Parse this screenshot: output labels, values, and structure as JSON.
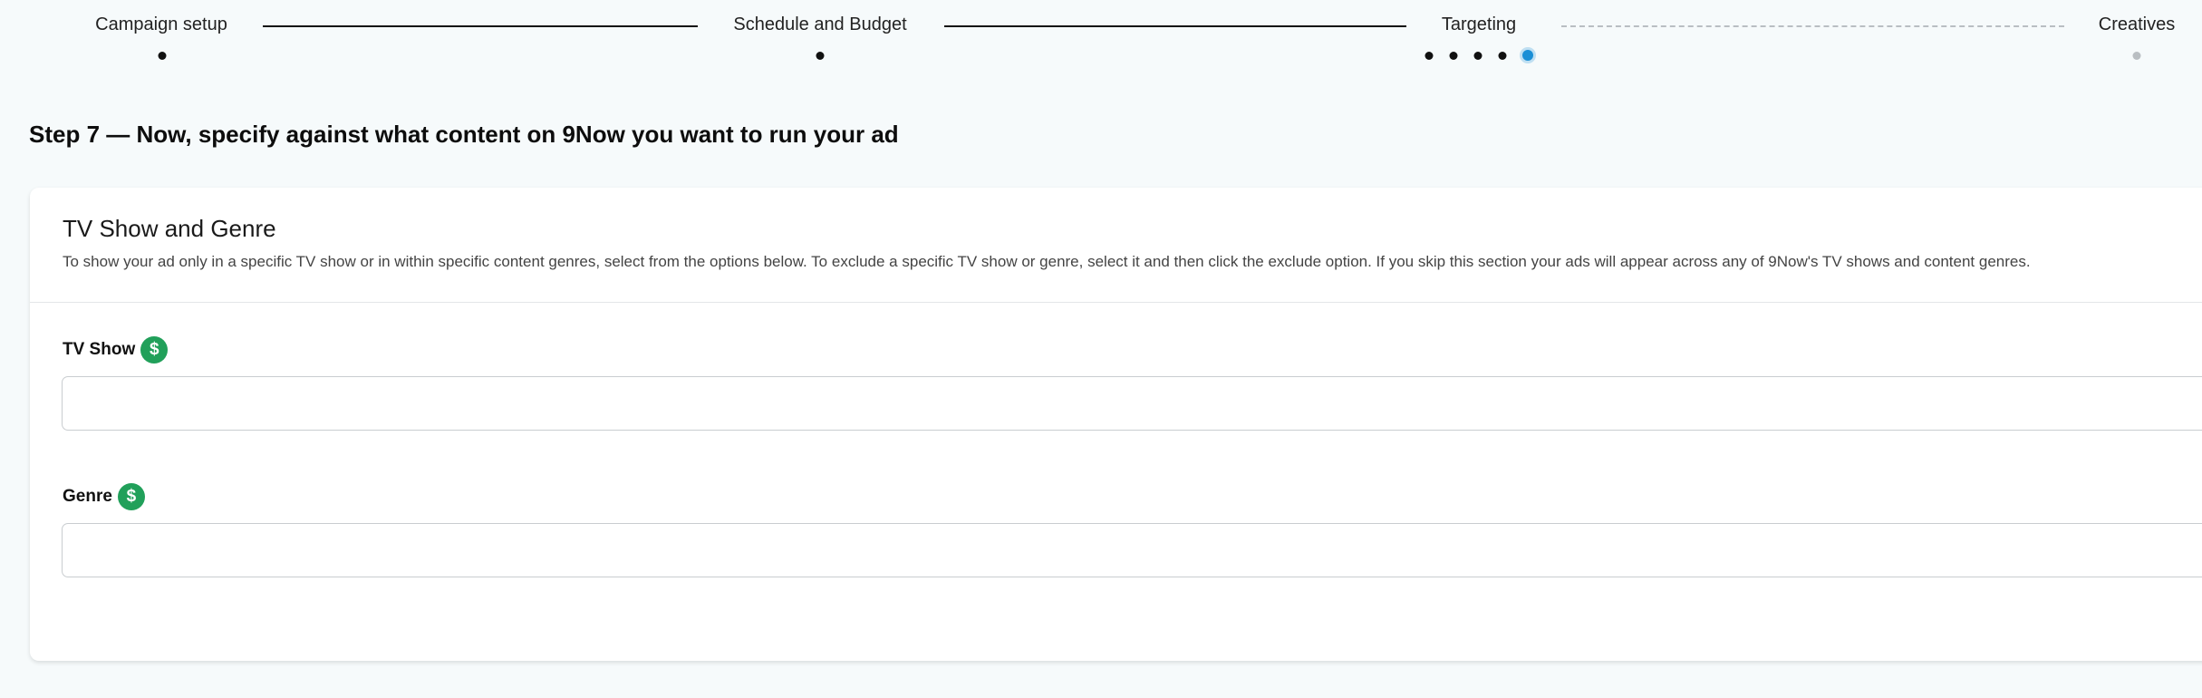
{
  "stepper": {
    "steps": [
      {
        "label": "Campaign setup",
        "state": "completed"
      },
      {
        "label": "Schedule and Budget",
        "state": "completed"
      },
      {
        "label": "Targeting",
        "state": "current",
        "substeps_total": 5,
        "substep_current": 5
      },
      {
        "label": "Creatives",
        "state": "upcoming"
      }
    ],
    "colors": {
      "completed": "#111111",
      "active": "#1a8fd6",
      "upcoming": "#b9bec2"
    }
  },
  "page": {
    "heading": "Step 7 — Now, specify against what content on 9Now you want to run your ad"
  },
  "card": {
    "title": "TV Show and Genre",
    "description": "To show your ad only in a specific TV show or in within specific content genres, select from the options below. To exclude a specific TV show or genre, select it and then click the exclude option. If you skip this section your ads will appear across any of 9Now's TV shows and content genres.",
    "fields": {
      "tv_show": {
        "label": "TV Show",
        "icon": "dollar-icon",
        "value": "",
        "placeholder": ""
      },
      "genre": {
        "label": "Genre",
        "icon": "dollar-icon",
        "value": "",
        "placeholder": ""
      }
    },
    "premium_icon_symbol": "$",
    "premium_icon_color": "#21a05a"
  }
}
